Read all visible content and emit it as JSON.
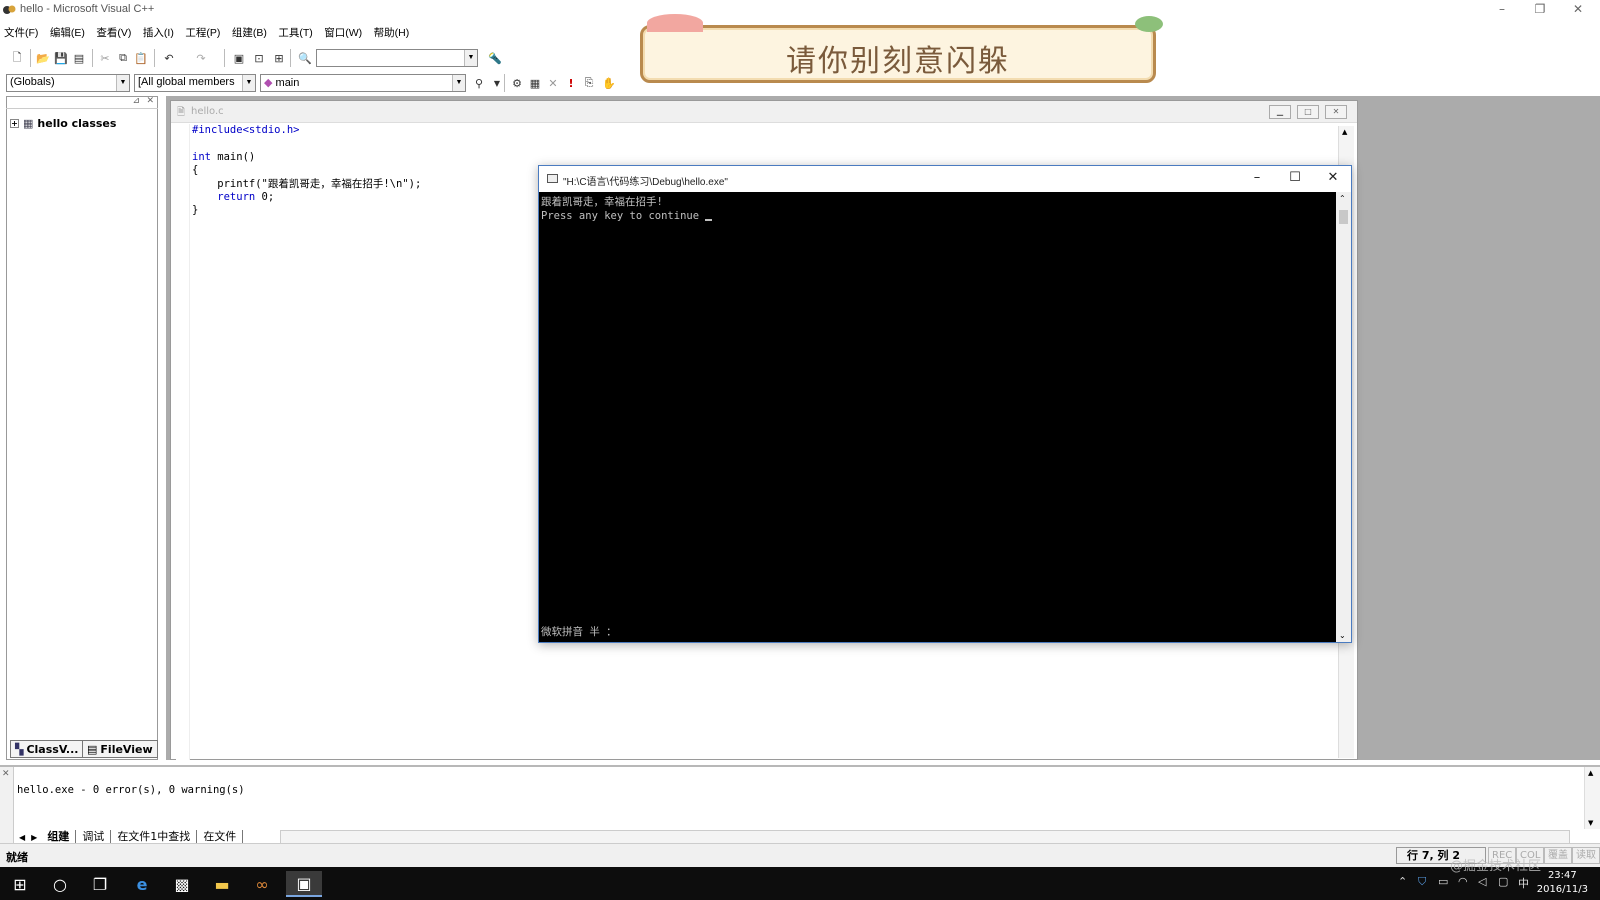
{
  "window": {
    "title": "hello - Microsoft Visual C++",
    "minimize": "–",
    "restore": "❐",
    "close": "✕"
  },
  "menu": [
    "文件(F)",
    "编辑(E)",
    "查看(V)",
    "插入(I)",
    "工程(P)",
    "组建(B)",
    "工具(T)",
    "窗口(W)",
    "帮助(H)"
  ],
  "toolbar": {
    "find_value": "",
    "scope_combo": "(Globals)",
    "members_combo": "[All global members",
    "function_combo": "main"
  },
  "lyric": "请你别刻意闪躲",
  "workspace": {
    "tree_root": "hello classes",
    "tab_classview": "ClassV...",
    "tab_fileview": "FileView"
  },
  "editor": {
    "file_title": "hello.c",
    "lines": {
      "l1": "#include<stdio.h>",
      "l3_kw": "int",
      "l3_rest": " main()",
      "l4": "{",
      "l5": "    printf(\"跟着凯哥走，幸福在招手!\\n\");",
      "l6_kw": "    return",
      "l6_rest": " 0;",
      "l7": "}"
    }
  },
  "console": {
    "title": "\"H:\\C语言\\代码练习\\Debug\\hello.exe\"",
    "line1": "跟着凯哥走，幸福在招手!",
    "line2": "Press any key to continue",
    "ime": "微软拼音 半 ："
  },
  "output": {
    "message": "hello.exe - 0 error(s), 0 warning(s)",
    "tabs": [
      "组建",
      "调试",
      "在文件1中查找",
      "在文件"
    ]
  },
  "status": {
    "ready": "就绪",
    "position": "行 7, 列 2",
    "rec": "REC",
    "col": "COL",
    "ovr": "覆盖",
    "read": "读取"
  },
  "taskbar": {
    "clock_time": "23:47",
    "clock_date": "2016/11/3",
    "ime": "中"
  },
  "watermark": "@掘金技术社区"
}
